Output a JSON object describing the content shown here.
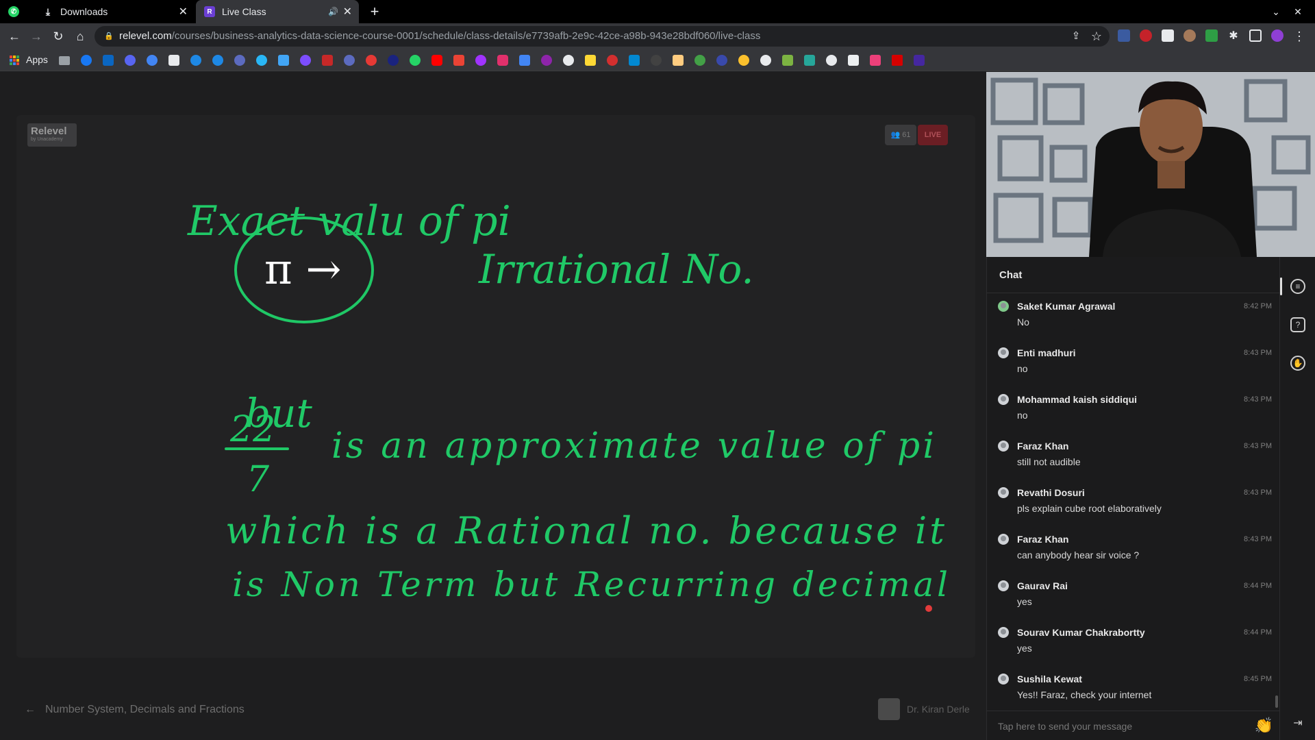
{
  "tabs": [
    {
      "label": "",
      "icon": "whatsapp-icon"
    },
    {
      "label": "Downloads",
      "icon": "download-icon"
    },
    {
      "label": "Live Class",
      "icon": "relevel-icon",
      "active": true
    }
  ],
  "address": {
    "host": "relevel.com",
    "path": "/courses/business-analytics-data-science-course-0001/schedule/class-details/e7739afb-2e9c-42ce-a98b-943e28bdf060/live-class"
  },
  "bookmarks": {
    "apps_label": "Apps"
  },
  "board": {
    "logo_title": "Relevel",
    "logo_sub": "by Unacademy",
    "viewer_count": "61",
    "live_label": "LIVE",
    "handwriting": [
      "Exact valu of pi",
      "π →",
      "Irrational No.",
      "but",
      "22",
      "7",
      "is an approximate value of pi",
      "which is a Rational no. because it",
      "is Non Term but Recurring decimal"
    ]
  },
  "footer": {
    "lesson_title": "Number System, Decimals and Fractions",
    "instructor": "Dr. Kiran Derle"
  },
  "chat": {
    "title": "Chat",
    "placeholder": "Tap here to send your message",
    "messages": [
      {
        "name": "Saket Kumar Agrawal",
        "time": "8:42 PM",
        "text": "No"
      },
      {
        "name": "Enti madhuri",
        "time": "8:43 PM",
        "text": "no"
      },
      {
        "name": "Mohammad kaish siddiqui",
        "time": "8:43 PM",
        "text": "no"
      },
      {
        "name": "Faraz Khan",
        "time": "8:43 PM",
        "text": "still not audible"
      },
      {
        "name": "Revathi Dosuri",
        "time": "8:43 PM",
        "text": "pls explain cube root elaboratively"
      },
      {
        "name": "Faraz Khan",
        "time": "8:43 PM",
        "text": "can anybody hear sir voice ?"
      },
      {
        "name": "Gaurav Rai",
        "time": "8:44 PM",
        "text": "yes"
      },
      {
        "name": "Sourav Kumar Chakrabortty",
        "time": "8:44 PM",
        "text": "yes"
      },
      {
        "name": "Sushila Kewat",
        "time": "8:45 PM",
        "text": "Yes!! Faraz, check your internet"
      }
    ]
  },
  "colors": {
    "ink": "#1fc866",
    "live": "#6b1e24",
    "chrome_dark": "#35363a"
  }
}
